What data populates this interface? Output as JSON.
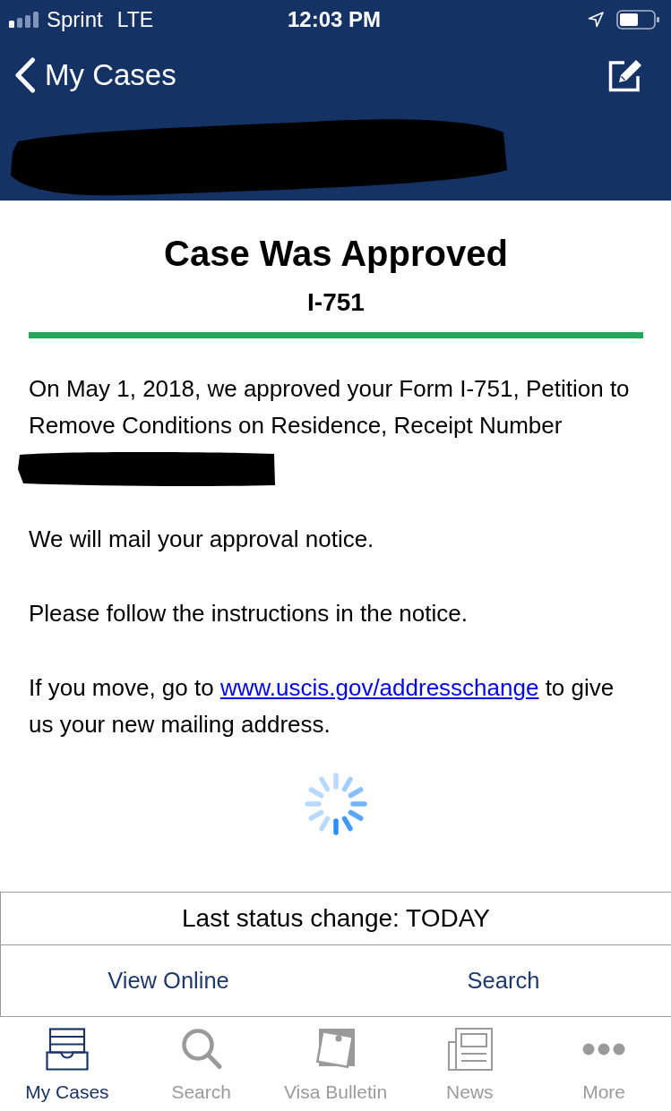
{
  "status_bar": {
    "carrier": "Sprint",
    "network": "LTE",
    "time": "12:03 PM"
  },
  "nav_bar": {
    "back_label": "My Cases",
    "title_redacted": true
  },
  "case": {
    "status": "Case Was Approved",
    "form": "I-751"
  },
  "message": [
    {
      "parts": [
        {
          "kind": "text",
          "text": "On May 1, 2018, we approved your Form I-751, Petition to Remove Conditions on Residence, Receipt Number"
        }
      ],
      "receipt_number_redacted": true
    },
    {
      "parts": [
        {
          "kind": "text",
          "text": "We will mail your approval notice."
        }
      ],
      "receipt_number_redacted": false
    },
    {
      "parts": [
        {
          "kind": "text",
          "text": "Please follow the instructions in the notice."
        }
      ],
      "receipt_number_redacted": false
    },
    {
      "parts": [
        {
          "kind": "text",
          "text": "If you move, go to "
        },
        {
          "kind": "link",
          "text": "www.uscis.gov/addresschange"
        },
        {
          "kind": "text",
          "text": " to give us your new mailing address."
        }
      ],
      "receipt_number_redacted": false
    }
  ],
  "loading": true,
  "last_status_change": "Last status change: TODAY",
  "actions": [
    "View Online",
    "Search"
  ],
  "tabs": [
    {
      "label": "My Cases",
      "selected": true
    },
    {
      "label": "Search",
      "selected": false
    },
    {
      "label": "Visa Bulletin",
      "selected": false
    },
    {
      "label": "News",
      "selected": false
    },
    {
      "label": "More",
      "selected": false
    }
  ]
}
